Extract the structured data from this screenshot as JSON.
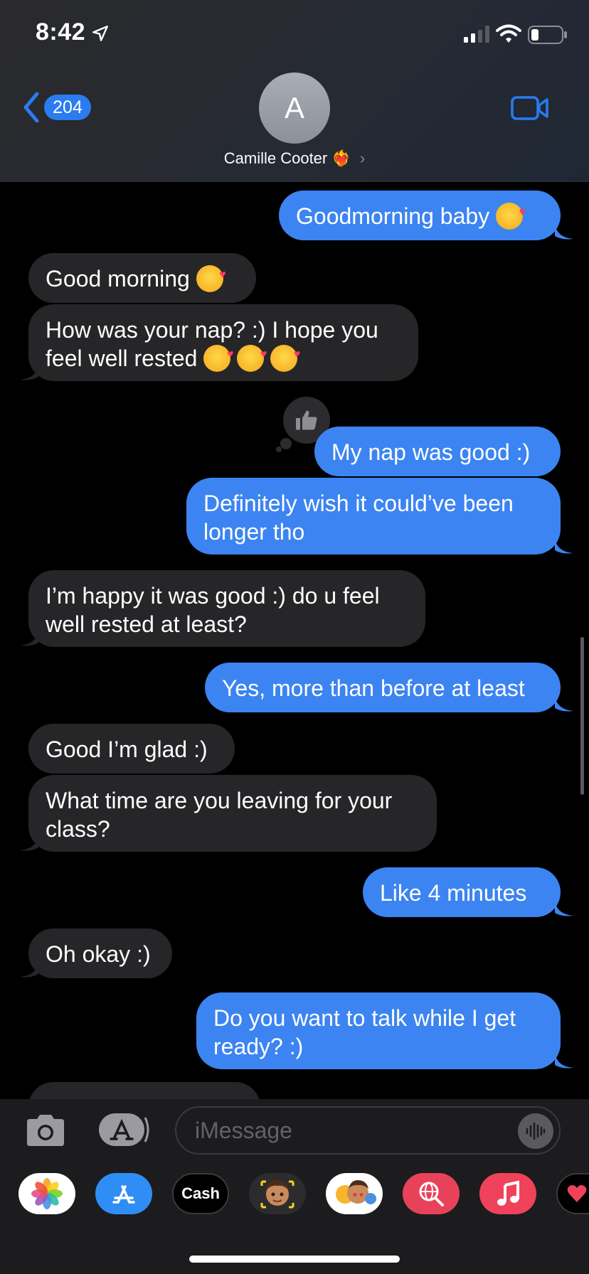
{
  "status_bar": {
    "time": "8:42"
  },
  "header": {
    "back_count": "204",
    "avatar_initial": "A",
    "contact_name": "Camille Cooter",
    "heart_emoji": "❤️‍🔥",
    "chevron": "›"
  },
  "messages": [
    {
      "id": "m1",
      "from": "me",
      "text": "Goodmorning baby",
      "emojis": 1
    },
    {
      "id": "m2",
      "from": "them",
      "text": "Good morning",
      "emojis": 1
    },
    {
      "id": "m3",
      "from": "them",
      "lines": [
        "How was your nap? :) I hope you",
        "feel well rested"
      ],
      "emojis": 3
    },
    {
      "id": "m4",
      "from": "me",
      "text": "My nap was good :)",
      "tapback": "thumbs-up"
    },
    {
      "id": "m5",
      "from": "me",
      "lines": [
        "Definitely wish it could’ve been",
        "longer tho"
      ]
    },
    {
      "id": "m6",
      "from": "them",
      "lines": [
        "I’m happy it was good :) do u feel",
        "well rested at least?"
      ]
    },
    {
      "id": "m7",
      "from": "me",
      "text": "Yes, more than before at least"
    },
    {
      "id": "m8",
      "from": "them",
      "text": "Good I’m glad :)"
    },
    {
      "id": "m9",
      "from": "them",
      "lines": [
        "What time are you leaving for your",
        "class?"
      ]
    },
    {
      "id": "m10",
      "from": "me",
      "text": "Like 4 minutes"
    },
    {
      "id": "m11",
      "from": "them",
      "text": "Oh okay :)"
    },
    {
      "id": "m12",
      "from": "me",
      "lines": [
        "Do you want to talk while I get",
        "ready? :)"
      ]
    }
  ],
  "input": {
    "placeholder": "iMessage"
  },
  "drawer": {
    "cash_label": "Cash",
    "cash_apple": ""
  },
  "colors": {
    "outgoing": "#3c84f1",
    "incoming": "#262628",
    "accent": "#2a7cf0"
  }
}
